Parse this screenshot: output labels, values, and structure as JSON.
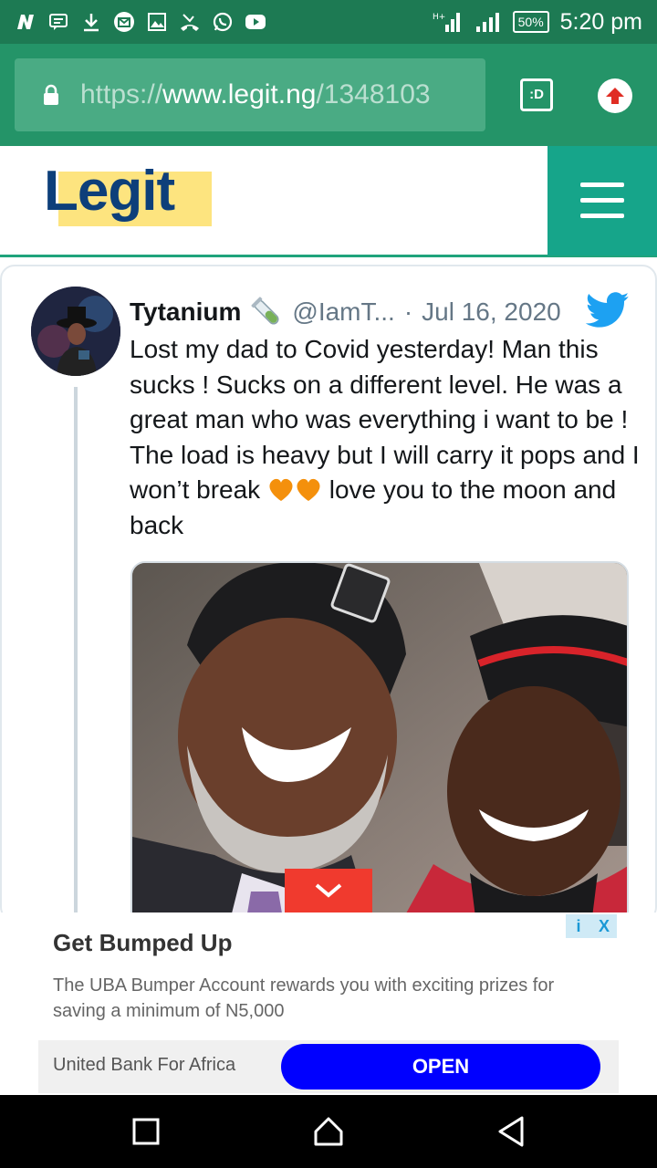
{
  "status_bar": {
    "battery": "50%",
    "time": "5:20 pm",
    "left_icons": [
      "n-icon",
      "message-icon",
      "download-icon",
      "mail-icon",
      "image-icon",
      "missed-call-icon",
      "whatsapp-icon",
      "youtube-icon"
    ]
  },
  "browser": {
    "url_scheme": "https://",
    "url_host": "www.legit.ng",
    "url_path": "/1348103",
    "tabs_label": ":D"
  },
  "site": {
    "logo": "Legit",
    "accent_color": "#16a58a",
    "logo_highlight": "#fde47f"
  },
  "tweet": {
    "name": "Tytanium",
    "handle": "@IamT...",
    "separator": "·",
    "date": "Jul 16, 2020",
    "text_part1": "Lost my dad to Covid yesterday! Man this sucks ! Sucks on a different level. He was a great man who was everything i want to be ! The load is heavy but I will carry it pops and I won’t break ",
    "text_part2": " love you to the moon and back"
  },
  "ad": {
    "title": "Get Bumped Up",
    "description": "The UBA Bumper Account rewards you with exciting prizes for saving a minimum of N5,000",
    "advertiser": "United Bank For Africa",
    "cta": "OPEN",
    "info_label": "i",
    "close_label": "X",
    "cta_color": "#0000ff"
  }
}
